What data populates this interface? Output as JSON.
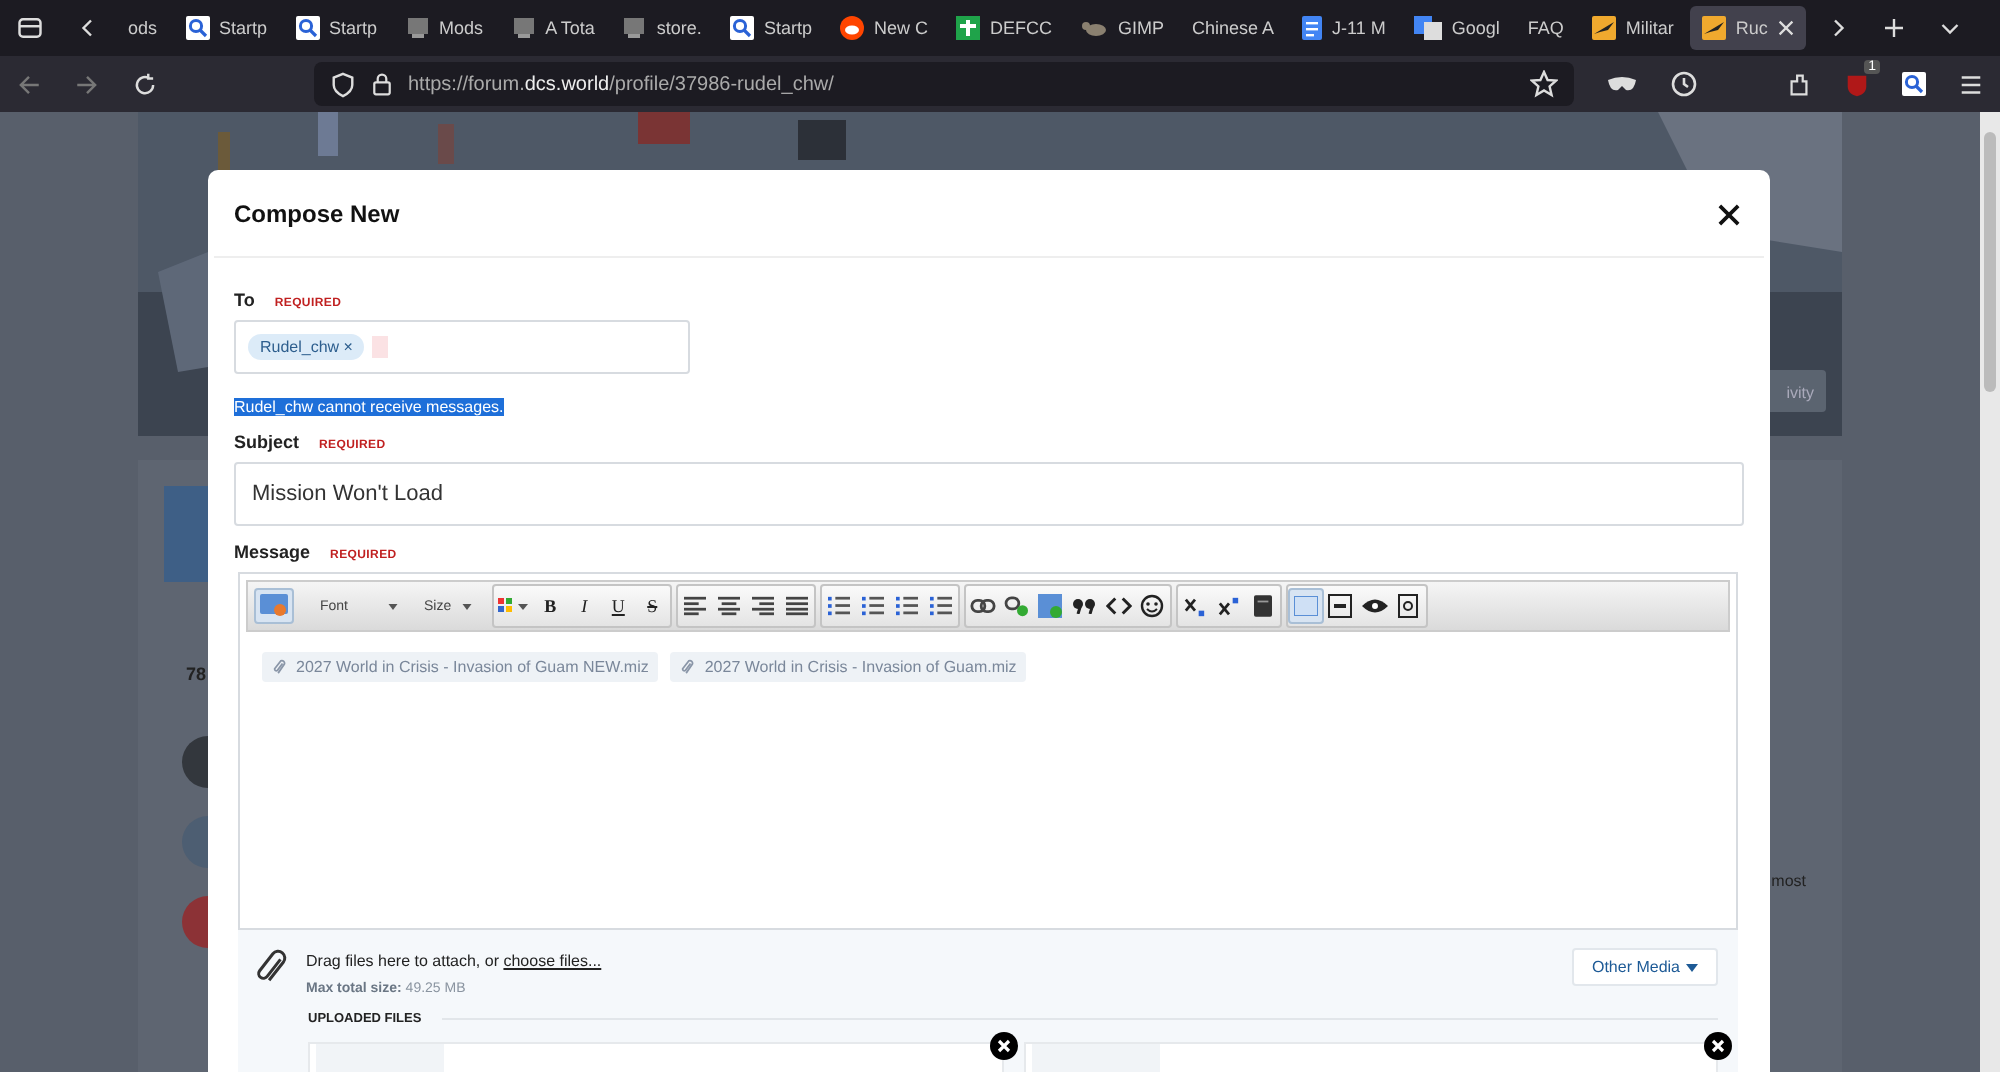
{
  "browser": {
    "tabs": [
      {
        "label": "ods",
        "kind": "plain",
        "selected": false
      },
      {
        "label": "Startp",
        "kind": "search",
        "selected": false
      },
      {
        "label": "Startp",
        "kind": "search",
        "selected": false
      },
      {
        "label": "Mods",
        "kind": "page",
        "selected": false
      },
      {
        "label": "A Tota",
        "kind": "page",
        "selected": false
      },
      {
        "label": "store.",
        "kind": "page",
        "selected": false
      },
      {
        "label": "Startp",
        "kind": "search",
        "selected": false
      },
      {
        "label": "New C",
        "kind": "alien",
        "selected": false
      },
      {
        "label": "DEFCC",
        "kind": "cross",
        "selected": false
      },
      {
        "label": "GIMP",
        "kind": "animal",
        "selected": false
      },
      {
        "label": "Chinese A",
        "kind": "plain",
        "selected": false
      },
      {
        "label": "J-11 M",
        "kind": "doc",
        "selected": false
      },
      {
        "label": "Googl",
        "kind": "translate",
        "selected": false
      },
      {
        "label": "FAQ",
        "kind": "plain",
        "selected": false
      },
      {
        "label": "Militar",
        "kind": "jet",
        "selected": false
      },
      {
        "label": "Ruc",
        "kind": "jet",
        "selected": true
      }
    ],
    "url": {
      "prefix": "https://forum.",
      "domain": "dcs.world",
      "path": "/profile/37986-rudel_chw/"
    },
    "extension_badge": "1"
  },
  "background": {
    "button": "ivity",
    "count": "78",
    "text": "most"
  },
  "dialog": {
    "title": "Compose New",
    "to": {
      "label": "To",
      "required": "REQUIRED",
      "recipients": [
        {
          "name": "Rudel_chw",
          "remove": "×"
        }
      ]
    },
    "notice": "Rudel_chw cannot receive messages.",
    "subject": {
      "label": "Subject",
      "required": "REQUIRED",
      "value": "Mission Won't Load"
    },
    "message": {
      "label": "Message",
      "required": "REQUIRED",
      "font": "Font",
      "size": "Size",
      "format": [
        {
          "label": "B",
          "kind": "bold"
        },
        {
          "label": "I",
          "kind": "italic"
        },
        {
          "label": "U",
          "kind": "underline"
        },
        {
          "label": "S",
          "kind": "strike"
        }
      ],
      "attachments": [
        "2027 World in Crisis - Invasion of Guam NEW.miz",
        "2027 World in Crisis - Invasion of Guam.miz"
      ]
    },
    "upload": {
      "prompt": "Drag files here to attach, or ",
      "link": "choose files...",
      "max_label": "Max total size:",
      "max_value": "49.25 MB",
      "other_media": "Other Media",
      "heading": "UPLOADED FILES",
      "files": [
        {
          "kind": "thumbnail"
        },
        {
          "kind": "thumbnail"
        }
      ]
    }
  }
}
